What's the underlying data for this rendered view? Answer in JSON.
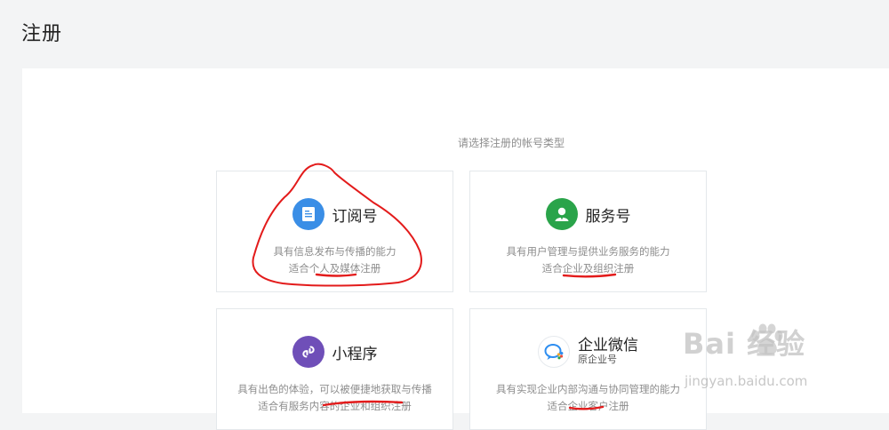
{
  "page": {
    "title": "注册"
  },
  "prompt": "请选择注册的帐号类型",
  "cards": [
    {
      "name": "订阅号",
      "desc1": "具有信息发布与传播的能力",
      "desc2": "适合个人及媒体注册",
      "color": "#3a8ee6",
      "icon": "document-icon"
    },
    {
      "name": "服务号",
      "desc1": "具有用户管理与提供业务服务的能力",
      "desc2": "适合企业及组织注册",
      "color": "#2aa44a",
      "icon": "person-icon"
    },
    {
      "name": "小程序",
      "desc1": "具有出色的体验，可以被便捷地获取与传播",
      "desc2": "适合有服务内容的企业和组织注册",
      "color": "#6f4fb8",
      "icon": "link-icon"
    },
    {
      "name": "企业微信",
      "subname": "原企业号",
      "desc1": "具有实现企业内部沟通与协同管理的能力",
      "desc2": "适合企业客户注册",
      "color": "#2e8ef0",
      "icon": "chat-bubble-icon"
    }
  ],
  "watermark": {
    "brand": "Bai 经验",
    "url": "jingyan.baidu.com"
  }
}
